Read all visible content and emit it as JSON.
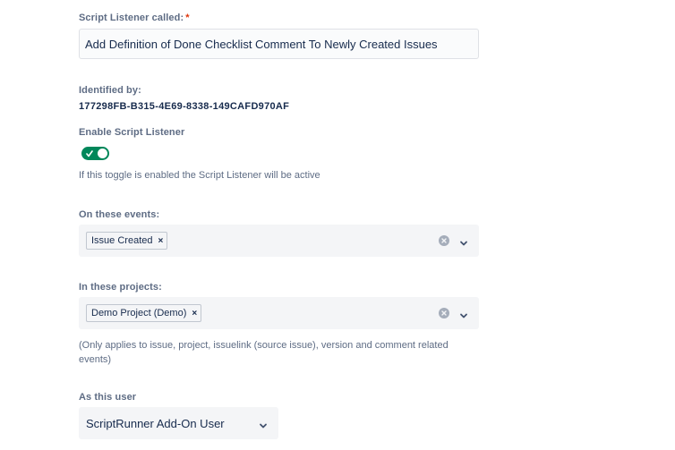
{
  "script_listener": {
    "label": "Script Listener called:",
    "required_mark": "*",
    "value": "Add Definition of Done Checklist Comment To Newly Created Issues"
  },
  "identified_by": {
    "label": "Identified by:",
    "value": "177298FB-B315-4E69-8338-149CAFD970AF"
  },
  "enable": {
    "label": "Enable Script Listener",
    "checked": true,
    "helper": "If this toggle is enabled the Script Listener will be active"
  },
  "events": {
    "label": "On these events:",
    "selected": [
      {
        "label": "Issue Created"
      }
    ],
    "remove_symbol": "×"
  },
  "projects": {
    "label": "In these projects:",
    "selected": [
      {
        "label": "Demo Project (Demo)"
      }
    ],
    "remove_symbol": "×",
    "helper": "(Only applies to issue, project, issuelink (source issue), version and comment related events)"
  },
  "user": {
    "label": "As this user",
    "value": "ScriptRunner Add-On User"
  },
  "colors": {
    "toggle_on": "#00875a",
    "required": "#de350b",
    "label": "#5e6c84",
    "text": "#172b4d",
    "field_bg": "#f4f5f7"
  },
  "icons": {
    "toggle_check": "check-icon",
    "clear": "clear-icon",
    "dropdown": "chevron-down-icon",
    "tag_remove": "close-icon"
  }
}
